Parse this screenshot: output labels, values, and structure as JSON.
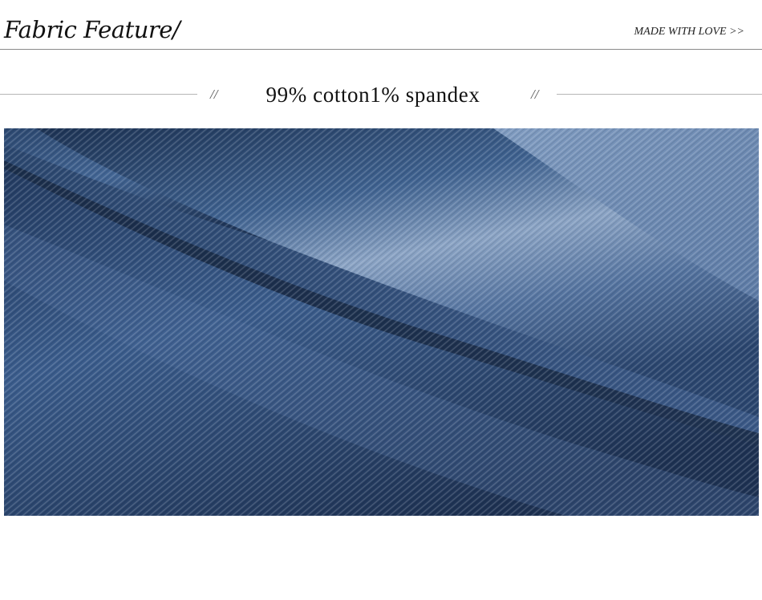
{
  "header": {
    "title": "Fabric Feature/",
    "tagline": "MADE WITH LOVE >>"
  },
  "section": {
    "mark_left": "//",
    "composition": "99% cotton1% spandex",
    "mark_right": "//"
  },
  "photo": {
    "subject": "denim-fabric-closeup",
    "colors": {
      "deep_indigo": "#1f3456",
      "mid_indigo": "#2f4d78",
      "faded_blue": "#6f8cb2",
      "light_wash": "#a7b9d4"
    }
  }
}
